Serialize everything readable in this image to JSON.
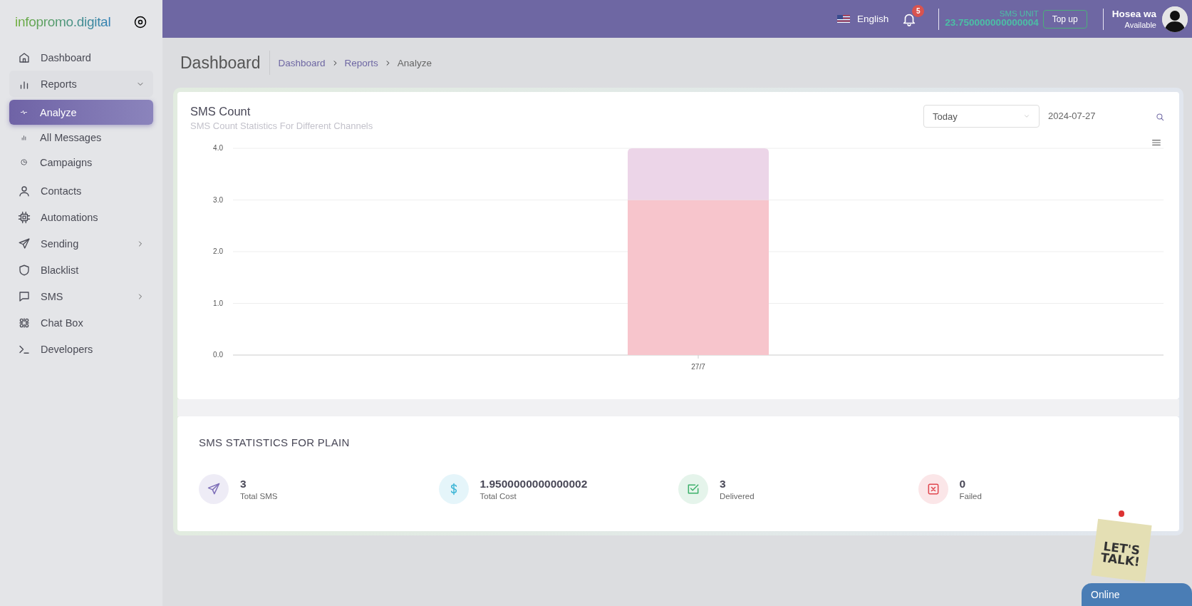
{
  "brand": "infopromo.digital",
  "sidebar": {
    "items": [
      {
        "label": "Dashboard",
        "selected": false
      },
      {
        "label": "Reports",
        "selected": false,
        "expanded": true,
        "children": [
          {
            "label": "Analyze",
            "selected": true
          },
          {
            "label": "All Messages",
            "selected": false
          },
          {
            "label": "Campaigns",
            "selected": false
          }
        ]
      },
      {
        "label": "Contacts",
        "selected": false
      },
      {
        "label": "Automations",
        "selected": false
      },
      {
        "label": "Sending",
        "selected": false,
        "expanded": false
      },
      {
        "label": "Blacklist",
        "selected": false
      },
      {
        "label": "SMS",
        "selected": false,
        "expanded": false
      },
      {
        "label": "Chat Box",
        "selected": false
      },
      {
        "label": "Developers",
        "selected": false
      }
    ]
  },
  "topbar": {
    "language": "English",
    "notifications": "5",
    "sms_unit_label": "SMS UNIT",
    "sms_unit_value": "23.750000000000004",
    "top_up": "Top up",
    "user_name": "Hosea wa",
    "user_status": "Available"
  },
  "page": {
    "title": "Dashboard",
    "breadcrumb": [
      {
        "label": "Dashboard",
        "current": false
      },
      {
        "label": "Reports",
        "current": false
      },
      {
        "label": "Analyze",
        "current": true
      }
    ]
  },
  "chart_card": {
    "title": "SMS Count",
    "subtitle": "SMS Count Statistics For Different Channels",
    "period": "Today",
    "date": "2024-07-27",
    "chart_data": {
      "type": "bar",
      "stacked": true,
      "grid": true,
      "categories": [
        "27/7"
      ],
      "series": [
        {
          "color": "#f7c5cc",
          "values": [
            3
          ]
        },
        {
          "color": "#ecd5e8",
          "values": [
            1
          ]
        }
      ],
      "ylim": [
        0,
        4
      ],
      "yticks": [
        {
          "value": 0,
          "label": "0.0"
        },
        {
          "value": 1,
          "label": "1.0"
        },
        {
          "value": 2,
          "label": "2.0"
        },
        {
          "value": 3,
          "label": "3.0"
        },
        {
          "value": 4,
          "label": "4.0"
        }
      ]
    }
  },
  "stats": {
    "title": "SMS STATISTICS FOR PLAIN",
    "items": [
      {
        "value": "3",
        "label": "Total SMS",
        "color": "#7e6fb8"
      },
      {
        "value": "1.9500000000000002",
        "label": "Total Cost",
        "color": "#3fb6d6"
      },
      {
        "value": "3",
        "label": "Delivered",
        "color": "#3cb06a"
      },
      {
        "value": "0",
        "label": "Failed",
        "color": "#e0474f"
      }
    ]
  },
  "chat_widget": {
    "sticker": "LET'S TALK!",
    "status": "Online"
  }
}
